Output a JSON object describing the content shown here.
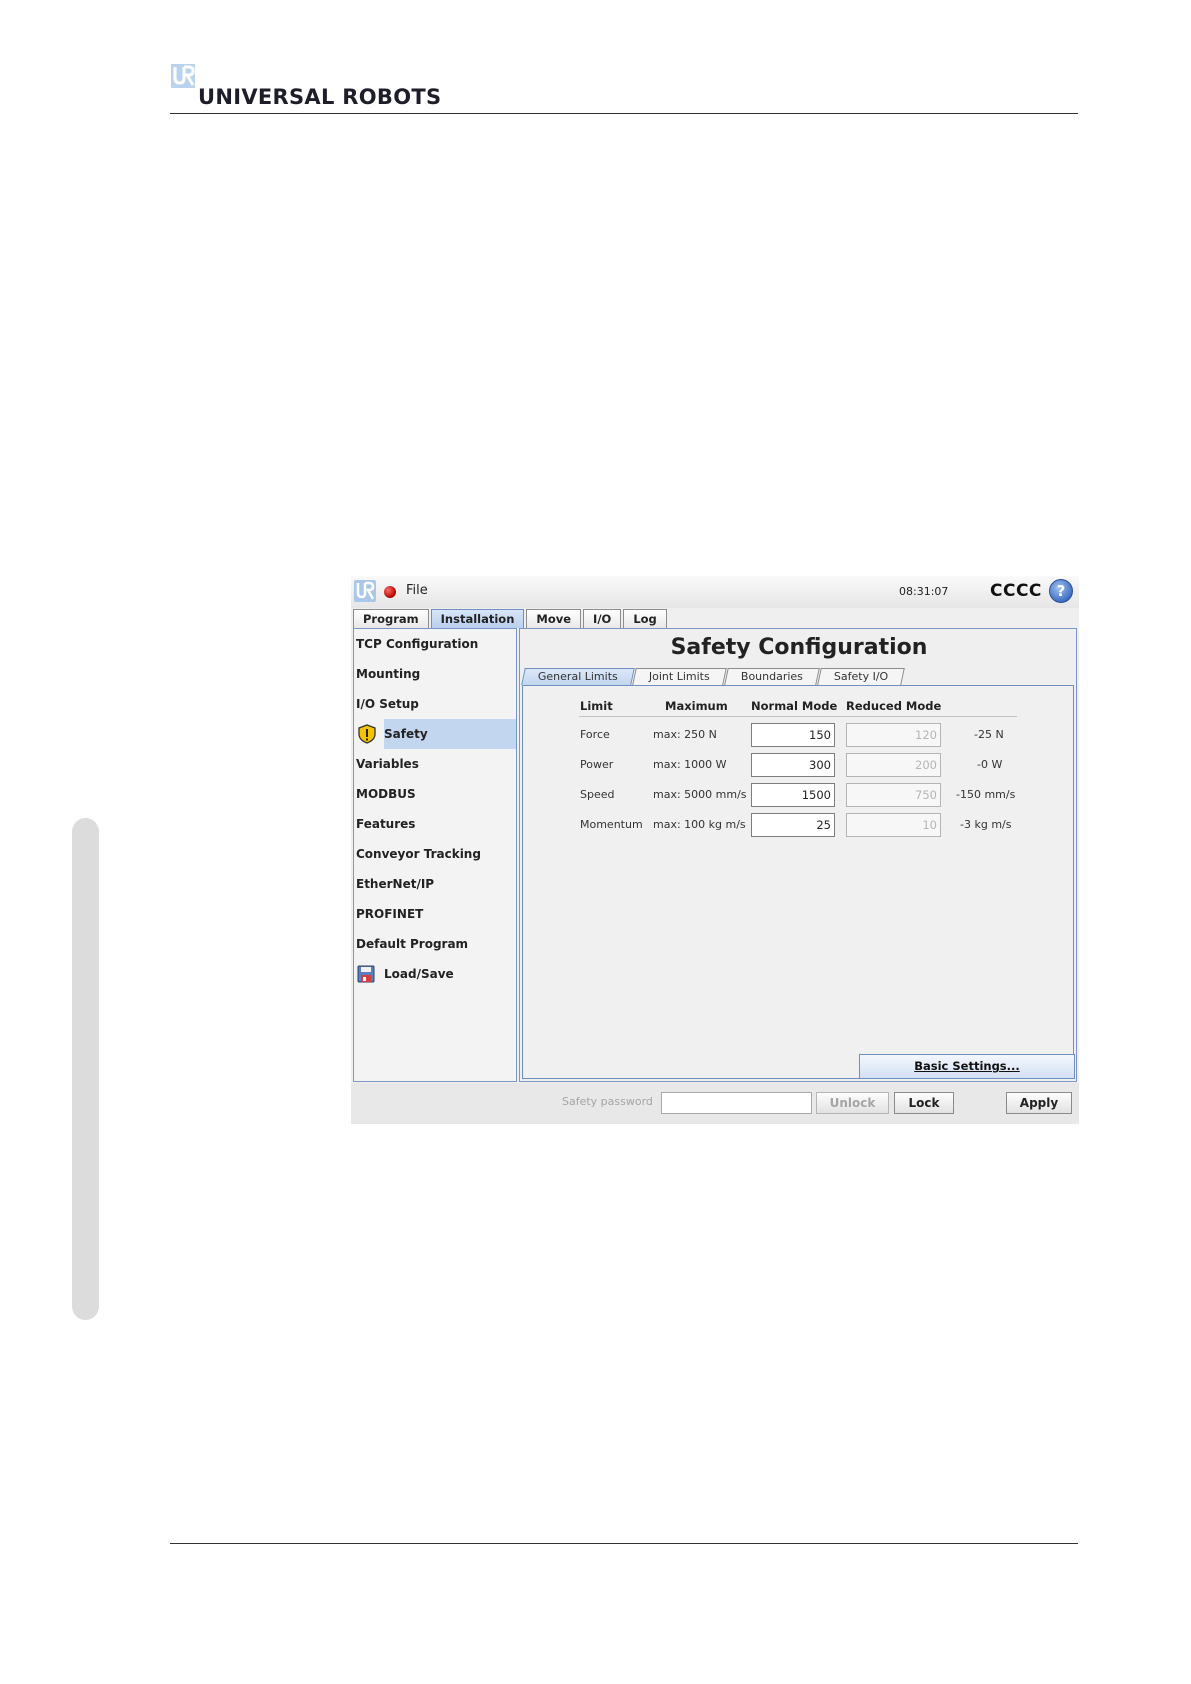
{
  "document": {
    "brand": "UNIVERSAL ROBOTS"
  },
  "window": {
    "menu_label": "File",
    "clock": "08:31:07",
    "robot_name": "CCCC",
    "help_glyph": "?",
    "icons": {
      "logo": "ur-logo-icon",
      "status": "red-status-dot-icon",
      "help": "help-icon"
    },
    "tabs": [
      {
        "label": "Program",
        "active": false
      },
      {
        "label": "Installation",
        "active": true
      },
      {
        "label": "Move",
        "active": false
      },
      {
        "label": "I/O",
        "active": false
      },
      {
        "label": "Log",
        "active": false
      }
    ]
  },
  "sidebar": {
    "items": [
      {
        "label": "TCP Configuration"
      },
      {
        "label": "Mounting"
      },
      {
        "label": "I/O Setup"
      },
      {
        "label": "Safety",
        "selected": true,
        "icon": "warning-shield-icon"
      },
      {
        "label": "Variables"
      },
      {
        "label": "MODBUS"
      },
      {
        "label": "Features"
      },
      {
        "label": "Conveyor Tracking"
      },
      {
        "label": "EtherNet/IP"
      },
      {
        "label": "PROFINET"
      },
      {
        "label": "Default Program"
      },
      {
        "label": "Load/Save",
        "icon": "floppy-disk-icon"
      }
    ]
  },
  "main": {
    "title": "Safety Configuration",
    "subtabs": [
      {
        "label": "General Limits",
        "active": true
      },
      {
        "label": "Joint Limits",
        "active": false
      },
      {
        "label": "Boundaries",
        "active": false
      },
      {
        "label": "Safety I/O",
        "active": false
      }
    ],
    "table": {
      "headers": [
        "Limit",
        "Maximum",
        "Normal Mode",
        "Reduced Mode"
      ],
      "rows": [
        {
          "limit": "Force",
          "maximum": "max: 250 N",
          "normal": "150",
          "reduced": "120",
          "delta": "-25 N"
        },
        {
          "limit": "Power",
          "maximum": "max: 1000 W",
          "normal": "300",
          "reduced": "200",
          "delta": "-0 W"
        },
        {
          "limit": "Speed",
          "maximum": "max: 5000 mm/s",
          "normal": "1500",
          "reduced": "750",
          "delta": "-150 mm/s"
        },
        {
          "limit": "Momentum",
          "maximum": "max: 100 kg m/s",
          "normal": "25",
          "reduced": "10",
          "delta": "-3 kg m/s"
        }
      ]
    },
    "basic_settings_button": "Basic Settings..."
  },
  "bottom": {
    "password_label": "Safety password",
    "password_value": "",
    "unlock_label": "Unlock",
    "lock_label": "Lock",
    "apply_label": "Apply"
  },
  "colors": {
    "accent": "#c3d6ef",
    "active_tab": "#b9d0ee",
    "border": "#7a97c7"
  }
}
